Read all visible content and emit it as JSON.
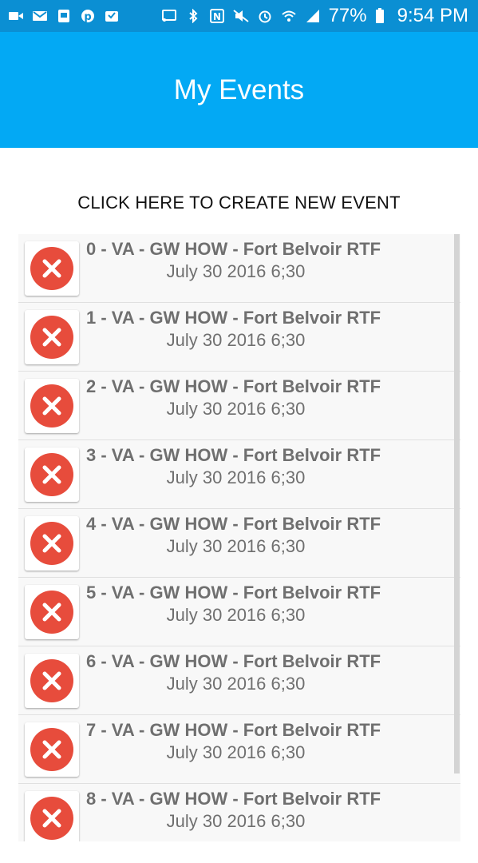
{
  "status_bar": {
    "left_icons": [
      "video-icon",
      "mail-icon",
      "clipboard-icon",
      "pinterest-icon",
      "inbox-icon"
    ],
    "right_icons": [
      "cast-icon",
      "bluetooth-icon",
      "nfc-icon",
      "mute-icon",
      "alarm-icon",
      "wifi-icon",
      "signal-icon"
    ],
    "battery": "77%",
    "time": "9:54 PM"
  },
  "app_bar": {
    "title": "My Events",
    "color": "#03a9f4"
  },
  "create_event_label": "CLICK HERE TO CREATE NEW EVENT",
  "events": [
    {
      "title": "0 - VA - GW HOW - Fort Belvoir RTF",
      "date": "July 30 2016 6;30"
    },
    {
      "title": "1 - VA - GW HOW - Fort Belvoir RTF",
      "date": "July 30 2016 6;30"
    },
    {
      "title": "2 - VA - GW HOW - Fort Belvoir RTF",
      "date": "July 30 2016 6;30"
    },
    {
      "title": "3 - VA - GW HOW - Fort Belvoir RTF",
      "date": "July 30 2016 6;30"
    },
    {
      "title": "4 - VA - GW HOW - Fort Belvoir RTF",
      "date": "July 30 2016 6;30"
    },
    {
      "title": "5 - VA - GW HOW - Fort Belvoir RTF",
      "date": "July 30 2016 6;30"
    },
    {
      "title": "6 - VA - GW HOW - Fort Belvoir RTF",
      "date": "July 30 2016 6;30"
    },
    {
      "title": "7 - VA - GW HOW - Fort Belvoir RTF",
      "date": "July 30 2016 6;30"
    },
    {
      "title": "8 - VA - GW HOW - Fort Belvoir RTF",
      "date": "July 30 2016 6;30"
    }
  ],
  "delete_icon": {
    "name": "close-circle-icon",
    "color": "#e74c3c"
  }
}
